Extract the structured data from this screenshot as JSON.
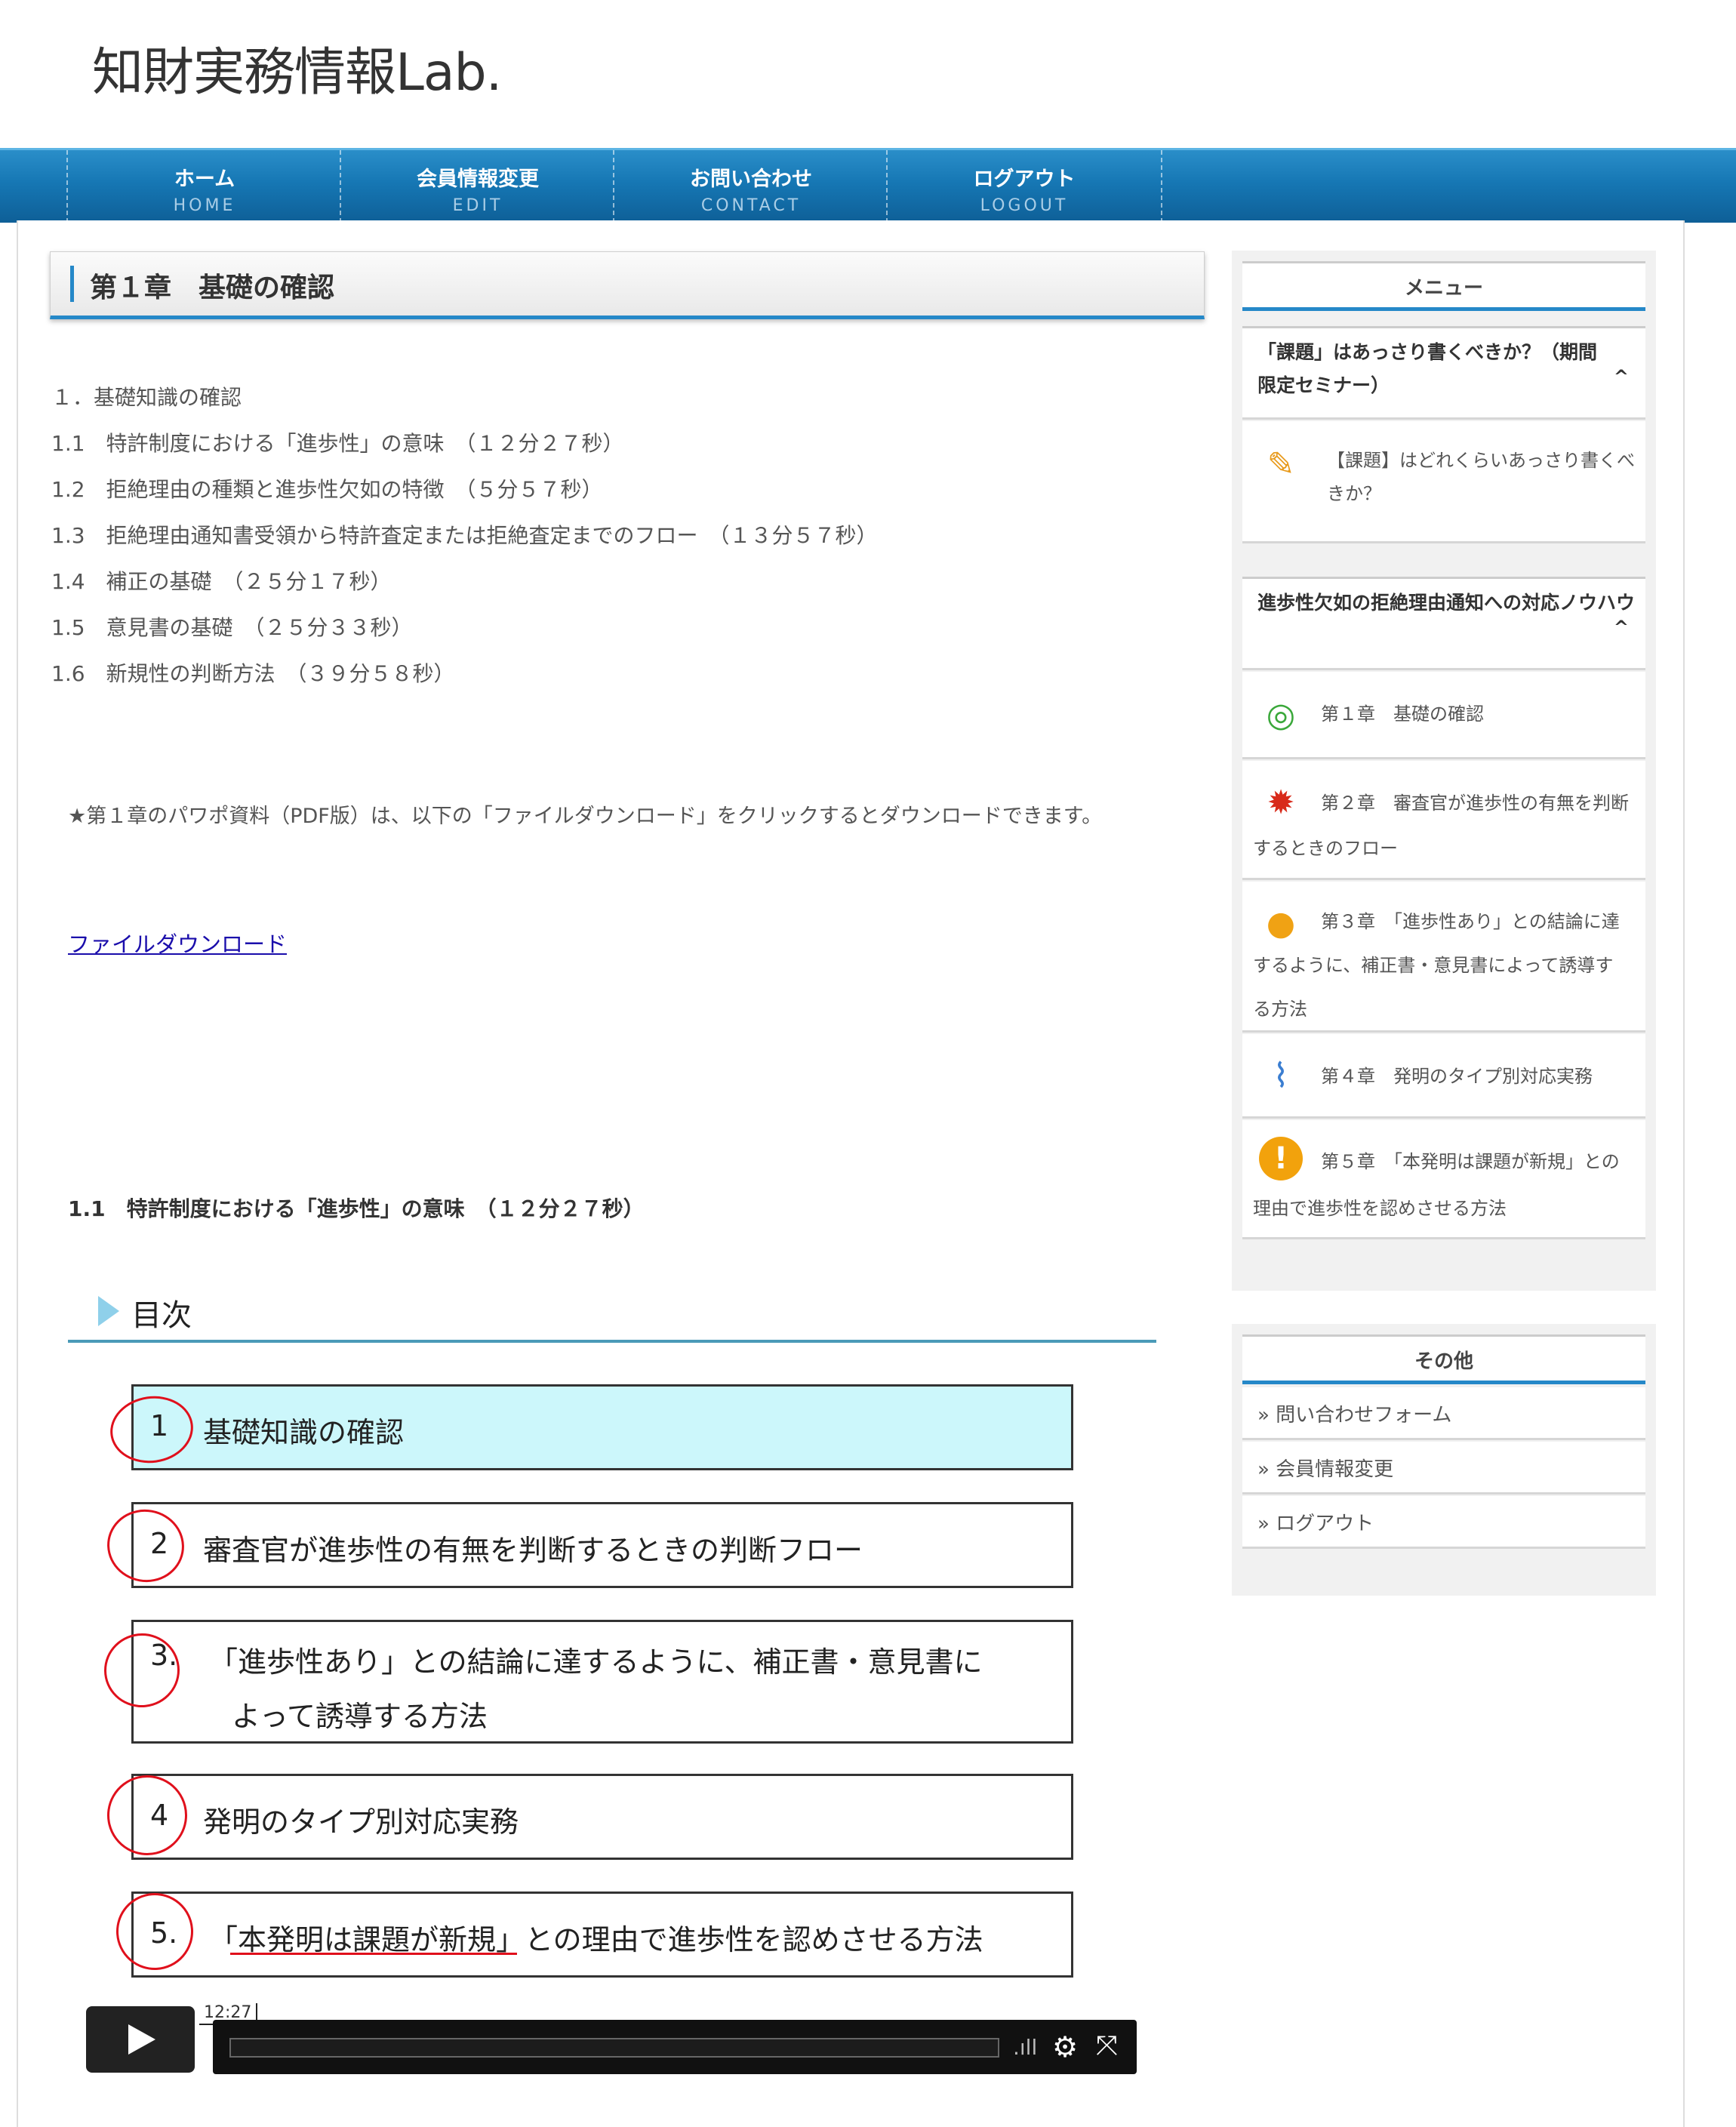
{
  "site": {
    "title": "知財実務情報Lab."
  },
  "nav": [
    {
      "jp": "ホーム",
      "en": "HOME"
    },
    {
      "jp": "会員情報変更",
      "en": "EDIT"
    },
    {
      "jp": "お問い合わせ",
      "en": "CONTACT"
    },
    {
      "jp": "ログアウト",
      "en": "LOGOUT"
    }
  ],
  "main": {
    "heading": "第１章　基礎の確認",
    "toc": [
      "１．基礎知識の確認",
      "1.1　特許制度における「進歩性」の意味　（１２分２７秒）",
      "1.2　拒絶理由の種類と進歩性欠如の特徴　（５分５７秒）",
      "1.3　拒絶理由通知書受領から特許査定または拒絶査定までのフロー　（１３分５７秒）",
      "1.4　補正の基礎　（２５分１７秒）",
      "1.5　意見書の基礎　（２５分３３秒）",
      "1.6　新規性の判断方法　（３９分５８秒）"
    ],
    "note": "★第１章のパワポ資料（PDF版）は、以下の「ファイルダウンロード」をクリックするとダウンロードできます。",
    "download_link": "ファイルダウンロード",
    "section_heading": "1.1　特許制度における「進歩性」の意味　（１２分２７秒）"
  },
  "slide": {
    "title": "目次",
    "items": [
      {
        "num": "1",
        "label": "基礎知識の確認"
      },
      {
        "num": "2",
        "label": "審査官が進歩性の有無を判断するときの判断フロー"
      },
      {
        "num": "3.",
        "label": "「進歩性あり」との結論に達するように、補正書・意見書に",
        "label2": "よって誘導する方法"
      },
      {
        "num": "4",
        "label": "発明のタイプ別対応実務"
      },
      {
        "num": "5.",
        "label": "「本発明は課題が新規」との理由で進歩性を認めさせる方法"
      }
    ]
  },
  "video": {
    "time": "12:27"
  },
  "sidebar": {
    "menu_title": "メニュー",
    "topic1": {
      "title": "「課題」はあっさり書くべきか？（期間限定セミナー）",
      "caret": "^"
    },
    "topic1_item": "【課題】はどれくらいあっさり書くべきか？",
    "topic2": {
      "title": "進歩性欠如の拒絶理由通知への対応ノウハウ",
      "caret": "^"
    },
    "chapters": [
      {
        "icon": "target-icon",
        "text": "第１章　基礎の確認"
      },
      {
        "icon": "award-icon",
        "text": "第２章　審査官が進歩性の有無を判断するときのフロー"
      },
      {
        "icon": "lightbulb-icon",
        "text": "第３章　「進歩性あり」との結論に達するように、補正書・意見書によって誘導する方法"
      },
      {
        "icon": "paperclip-icon",
        "text": "第４章　発明のタイプ別対応実務"
      },
      {
        "icon": "exclamation-icon",
        "text": "第５章　「本発明は課題が新規」との理由で進歩性を認めさせる方法"
      }
    ],
    "other_title": "その他",
    "other_links": [
      "問い合わせフォーム",
      "会員情報変更",
      "ログアウト"
    ]
  },
  "colors": {
    "accent": "#2588c8",
    "nav": "#1677b4",
    "highlight": "#ccf7fb",
    "annotation": "#e0101c"
  }
}
